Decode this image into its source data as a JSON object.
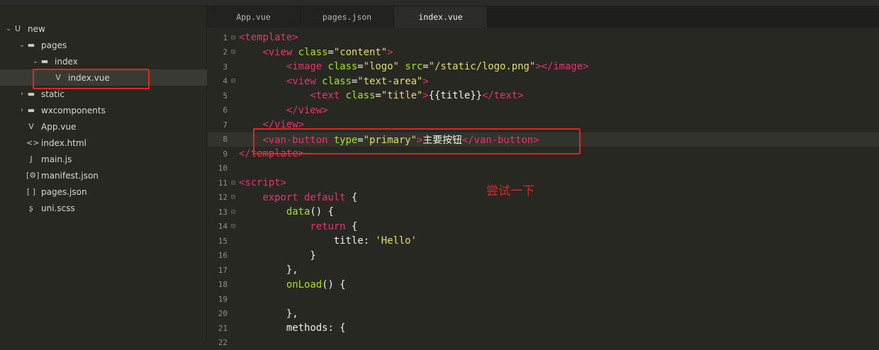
{
  "tabs": [
    {
      "label": "App.vue"
    },
    {
      "label": "pages.json"
    },
    {
      "label": "index.vue",
      "active": true
    }
  ],
  "tree": [
    {
      "label": "new",
      "icon": "project-icon",
      "glyph": "U",
      "chev": "⌄",
      "depth": 0
    },
    {
      "label": "pages",
      "icon": "folder-icon",
      "glyph": "▬",
      "chev": "⌄",
      "depth": 1
    },
    {
      "label": "index",
      "icon": "folder-icon",
      "glyph": "▬",
      "chev": "⌄",
      "depth": 2
    },
    {
      "label": "index.vue",
      "icon": "vue-file-icon",
      "glyph": "V",
      "chev": "",
      "depth": 3,
      "selected": true
    },
    {
      "label": "static",
      "icon": "folder-icon",
      "glyph": "▬",
      "chev": "›",
      "depth": 1
    },
    {
      "label": "wxcomponents",
      "icon": "folder-icon",
      "glyph": "▬",
      "chev": "›",
      "depth": 1
    },
    {
      "label": "App.vue",
      "icon": "vue-file-icon",
      "glyph": "V",
      "chev": "",
      "depth": 1
    },
    {
      "label": "index.html",
      "icon": "html-file-icon",
      "glyph": "<>",
      "chev": "",
      "depth": 1
    },
    {
      "label": "main.js",
      "icon": "js-file-icon",
      "glyph": "J",
      "chev": "",
      "depth": 1
    },
    {
      "label": "manifest.json",
      "icon": "json-settings-icon",
      "glyph": "[⚙]",
      "chev": "",
      "depth": 1
    },
    {
      "label": "pages.json",
      "icon": "json-file-icon",
      "glyph": "[ ]",
      "chev": "",
      "depth": 1
    },
    {
      "label": "uni.scss",
      "icon": "scss-file-icon",
      "glyph": "ʂ",
      "chev": "",
      "depth": 1
    }
  ],
  "code": [
    {
      "n": "1",
      "fold": true,
      "t": [
        [
          "tag",
          "<template>"
        ]
      ]
    },
    {
      "n": "2",
      "fold": true,
      "t": [
        [
          "p",
          "    "
        ],
        [
          "tag",
          "<view "
        ],
        [
          "attr",
          "class"
        ],
        [
          "p",
          "="
        ],
        [
          "str",
          "\"content\""
        ],
        [
          "tag",
          ">"
        ]
      ]
    },
    {
      "n": "3",
      "t": [
        [
          "p",
          "        "
        ],
        [
          "tag",
          "<image "
        ],
        [
          "attr",
          "class"
        ],
        [
          "p",
          "="
        ],
        [
          "str",
          "\"logo\" "
        ],
        [
          "attr",
          "src"
        ],
        [
          "p",
          "="
        ],
        [
          "str",
          "\"/static/logo.png\""
        ],
        [
          "tag",
          "></image>"
        ]
      ]
    },
    {
      "n": "4",
      "fold": true,
      "t": [
        [
          "p",
          "        "
        ],
        [
          "tag",
          "<view "
        ],
        [
          "attr",
          "class"
        ],
        [
          "p",
          "="
        ],
        [
          "str",
          "\"text-area\""
        ],
        [
          "tag",
          ">"
        ]
      ]
    },
    {
      "n": "5",
      "t": [
        [
          "p",
          "            "
        ],
        [
          "tag",
          "<text "
        ],
        [
          "attr",
          "class"
        ],
        [
          "p",
          "="
        ],
        [
          "str",
          "\"title\""
        ],
        [
          "tag",
          ">"
        ],
        [
          "p",
          "{{title}}"
        ],
        [
          "tag",
          "</text>"
        ]
      ]
    },
    {
      "n": "6",
      "t": [
        [
          "p",
          "        "
        ],
        [
          "tag",
          "</view>"
        ]
      ]
    },
    {
      "n": "7",
      "t": [
        [
          "p",
          "    "
        ],
        [
          "tag",
          "</view>"
        ]
      ]
    },
    {
      "n": "8",
      "cur": true,
      "t": [
        [
          "p",
          "    "
        ],
        [
          "tag",
          "<van-button "
        ],
        [
          "attr",
          "type"
        ],
        [
          "p",
          "="
        ],
        [
          "str",
          "\"primary\""
        ],
        [
          "tag",
          ">"
        ],
        [
          "p",
          "主要按钮"
        ],
        [
          "tag",
          "</van-button>"
        ]
      ]
    },
    {
      "n": "9",
      "t": [
        [
          "tag",
          "</template>"
        ]
      ]
    },
    {
      "n": "10",
      "t": []
    },
    {
      "n": "11",
      "fold": true,
      "t": [
        [
          "tag",
          "<script>"
        ]
      ]
    },
    {
      "n": "12",
      "fold": true,
      "t": [
        [
          "p",
          "    "
        ],
        [
          "kw",
          "export default "
        ],
        [
          "p",
          "{"
        ]
      ]
    },
    {
      "n": "13",
      "fold": true,
      "t": [
        [
          "p",
          "        "
        ],
        [
          "fn",
          "data"
        ],
        [
          "p",
          "() {"
        ]
      ]
    },
    {
      "n": "14",
      "fold": true,
      "t": [
        [
          "p",
          "            "
        ],
        [
          "kw",
          "return "
        ],
        [
          "p",
          "{"
        ]
      ]
    },
    {
      "n": "15",
      "t": [
        [
          "p",
          "                title: "
        ],
        [
          "str",
          "'Hello'"
        ]
      ]
    },
    {
      "n": "16",
      "t": [
        [
          "p",
          "            }"
        ]
      ]
    },
    {
      "n": "17",
      "t": [
        [
          "p",
          "        },"
        ]
      ]
    },
    {
      "n": "18",
      "t": [
        [
          "p",
          "        "
        ],
        [
          "fn",
          "onLoad"
        ],
        [
          "p",
          "() {"
        ]
      ]
    },
    {
      "n": "19",
      "t": []
    },
    {
      "n": "20",
      "t": [
        [
          "p",
          "        },"
        ]
      ]
    },
    {
      "n": "21",
      "t": [
        [
          "p",
          "        methods: {"
        ]
      ]
    },
    {
      "n": "22",
      "t": []
    }
  ],
  "annotation": "尝试一下",
  "colors": {
    "highlight": "#e8231f",
    "tag": "#e8336f",
    "attr": "#a6e22e",
    "string": "#e6db74"
  }
}
